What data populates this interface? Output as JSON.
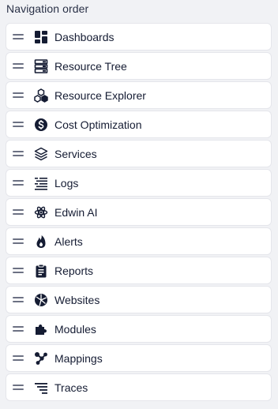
{
  "heading": "Navigation order",
  "items": [
    {
      "label": "Dashboards",
      "icon": "dashboards-icon"
    },
    {
      "label": "Resource Tree",
      "icon": "resource-tree-icon"
    },
    {
      "label": "Resource Explorer",
      "icon": "resource-explorer-icon"
    },
    {
      "label": "Cost Optimization",
      "icon": "cost-optimization-icon"
    },
    {
      "label": "Services",
      "icon": "services-icon"
    },
    {
      "label": "Logs",
      "icon": "logs-icon"
    },
    {
      "label": "Edwin AI",
      "icon": "edwin-ai-icon"
    },
    {
      "label": "Alerts",
      "icon": "alerts-icon"
    },
    {
      "label": "Reports",
      "icon": "reports-icon"
    },
    {
      "label": "Websites",
      "icon": "websites-icon"
    },
    {
      "label": "Modules",
      "icon": "modules-icon"
    },
    {
      "label": "Mappings",
      "icon": "mappings-icon"
    },
    {
      "label": "Traces",
      "icon": "traces-icon"
    }
  ],
  "colors": {
    "background": "#f1f2f5",
    "card": "#ffffff",
    "icon": "#151c33",
    "handle": "#6c7183"
  }
}
